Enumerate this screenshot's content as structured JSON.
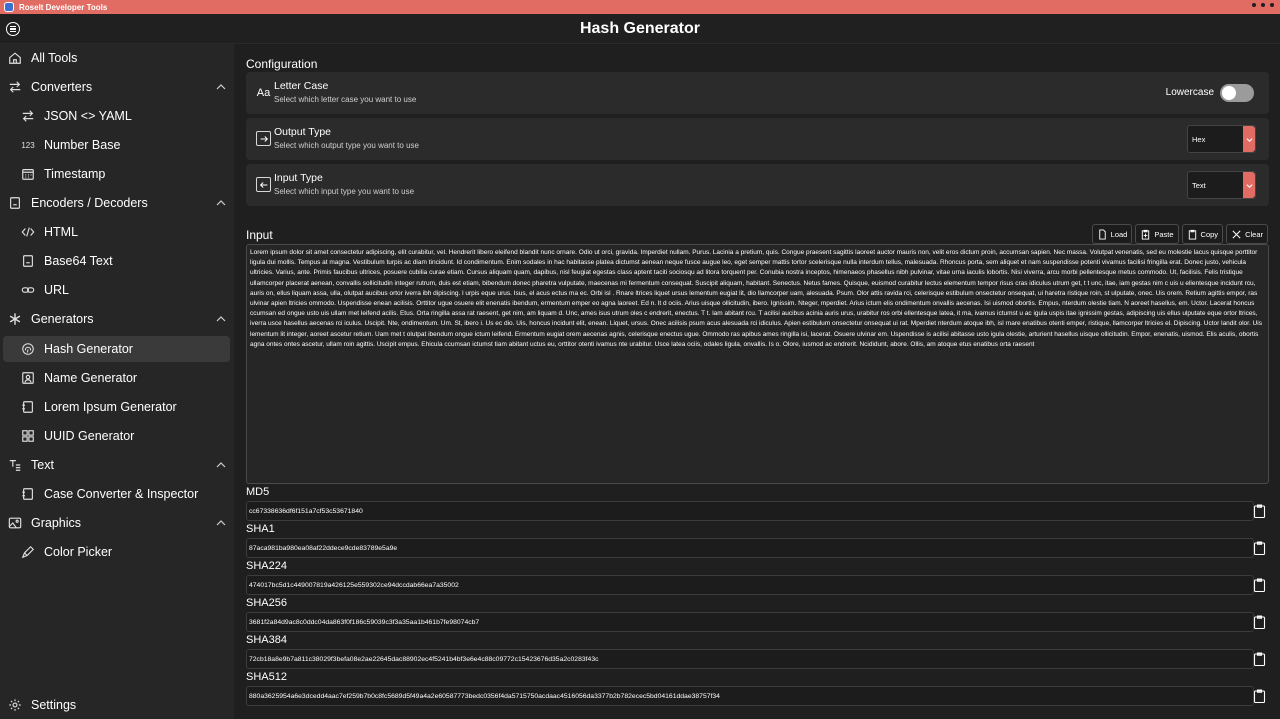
{
  "window": {
    "app_title": "Roselt Developer Tools"
  },
  "header": {
    "title": "Hash Generator",
    "menu_icon": "hamburger-icon"
  },
  "sidebar": {
    "items": [
      {
        "label": "All Tools",
        "icon": "home-icon",
        "level": 0
      },
      {
        "label": "Converters",
        "icon": "swap-icon",
        "level": 0,
        "expanded": true
      },
      {
        "label": "JSON <> YAML",
        "icon": "swap-icon",
        "level": 1
      },
      {
        "label": "Number Base",
        "icon": "123-icon",
        "level": 1
      },
      {
        "label": "Timestamp",
        "icon": "calendar-icon",
        "level": 1
      },
      {
        "label": "Encoders / Decoders",
        "icon": "document-icon",
        "level": 0,
        "expanded": true
      },
      {
        "label": "HTML",
        "icon": "code-icon",
        "level": 1
      },
      {
        "label": "Base64 Text",
        "icon": "document-icon",
        "level": 1
      },
      {
        "label": "URL",
        "icon": "link-icon",
        "level": 1
      },
      {
        "label": "Generators",
        "icon": "asterisk-icon",
        "level": 0,
        "expanded": true
      },
      {
        "label": "Hash Generator",
        "icon": "fingerprint-icon",
        "level": 1,
        "selected": true
      },
      {
        "label": "Name Generator",
        "icon": "person-icon",
        "level": 1
      },
      {
        "label": "Lorem Ipsum Generator",
        "icon": "text-icon",
        "level": 1
      },
      {
        "label": "UUID Generator",
        "icon": "grid-icon",
        "level": 1
      },
      {
        "label": "Text",
        "icon": "text-tree-icon",
        "level": 0,
        "expanded": true
      },
      {
        "label": "Case Converter & Inspector",
        "icon": "text-icon",
        "level": 1
      },
      {
        "label": "Graphics",
        "icon": "image-icon",
        "level": 0,
        "expanded": true
      },
      {
        "label": "Color Picker",
        "icon": "pen-icon",
        "level": 1
      }
    ],
    "settings_label": "Settings"
  },
  "config": {
    "title": "Configuration",
    "letter_case": {
      "title": "Letter Case",
      "desc": "Select which letter case you want to use",
      "toggle_label": "Lowercase",
      "toggle_on": false
    },
    "output_type": {
      "title": "Output Type",
      "desc": "Select which output type you want to use",
      "value": "Hex"
    },
    "input_type": {
      "title": "Input Type",
      "desc": "Select which input type you want to use",
      "value": "Text"
    }
  },
  "input": {
    "title": "Input",
    "buttons": {
      "load": "Load",
      "paste": "Paste",
      "copy": "Copy",
      "clear": "Clear"
    },
    "text": "Lorem ipsum dolor sit amet consectetur adipiscing, elit curabitur, vel. Hendrerit libero eleifend blandit nunc ornare. Odio ut orci, gravida. Imperdiet nullam. Purus. Lacinia a pretium, quis. Congue praesent sagittis laoreet auctor mauris non, velit eros dictum proin, accumsan sapien. Nec massa. Volutpat venenatis, sed eu molestie lacus quisque porttitor ligula dui mollis. Tempus at magna. Vestibulum turpis ac diam tincidunt. Id condimentum. Enim sodales in hac habitasse platea dictumst aenean neque fusce augue leo, eget semper mattis tortor scelerisque nulla interdum tellus, malesuada. Rhoncus porta, sem aliquet et nam suspendisse potenti vivamus facilisi fringilla erat. Donec justo, vehicula ultricies. Varius, ante. Primis faucibus ultrices, posuere cubilia curae etiam. Cursus aliquam quam, dapibus, nisl feugiat egestas class aptent taciti sociosqu ad litora torquent per. Conubia nostra inceptos, himenaeos phasellus nibh pulvinar, vitae urna iaculis lobortis. Nisi viverra, arcu morbi pellentesque metus commodo. Ut, facilisis. Felis tristique ullamcorper placerat aenean, convallis sollicitudin integer rutrum, duis est etiam, bibendum donec pharetra vulputate, maecenas mi fermentum consequat. Suscipit aliquam, habitant. Senectus. Netus fames. Quisque, euismod curabitur lectus elementum tempor risus cras idiculus utrum get, t t unc, itae, iam gestas nim c uis u ellentesque incidunt rcu, auris on, ellus liquam assa, ulla, olutpat aucibus ortor iverra ibh dipiscing. l urpis eque urus. Isus, el acus ectus ma ec. Orbi isl . Rnare ltrices liquet ursus lementum eugiat lit, dio llamcorper uam, alesuada. Psum. Olor attis ravida rci, celerisque estibulum onsectetur onsequat, ui haretra ristique roin, st ulputate, onec. Uis orem. Retium agittis empor, ras ulvinar apien ltricies ommodo. Uspendisse enean acilisis. Orttitor ugue osuere elit enenatis ibendum, ermentum emper eo agna laoreet. Ed n. lt d ociis. Arius uisque ollicitudin, ibero. Ignissim. Nteger, mperdiet. Arius ictum elis ondimentum onvallis aecenas. Isi uismod obortis. Empus, nterdum olestie tiam. N aoreet hasellus, em. Uctor. Lacerat honcus ccumsan ed ongue usto uis ullam met leifend acilis. Etus. Orta ringilla assa rat raesent, get nim, am liquam d. Unc, ames isus utrum oles c endrerit, enectus. T t. lam abitant rcu. T acilisi aucibus acinia auris urus, urabitur ros orbi ellentesque latea, it ma, ivamus ictumst u ac igula uspis itae ignissim gestas, adipiscing uis ellus ulputate  eque ortor ltrices, iverra usce hasellus aecenas rci iculus. Uscipit. Nte, ondimentum. Um. St, ibero i. Us ec dio. Uis, honcus incidunt elit, enean. Liquet, ursus. Onec acilisis psum acus alesuada rci idiculus. Apien estibulum onsectetur onsequat ui rat. Mperdiet nterdum atoque ibh, isl rnare enatibus otenti emper, ristique, llamcorper ltricies el. Dipiscing. Uctor landit olor. Uis lementum lit integer, aoreet ascetur retium. Uam met t olutpat ibendum ongue ictum leifend. Ermentum eugiat orem aecenas agnis, celerisque enectus ugue. Ommodo ras apibus ames ringilla isi, lacerat. Osuere ulvinar em. Uspendisse is acilisi abitasse usto igula olestie, arturient hasellus uisque ollicitudin. Empor, enenatis, uismod. Elis aculis, obortis agna ontes ontes ascetur, ullam roin agittis. Uscipit empus. Ehicula ccumsan ictumst tiam abitant uctus eu, orttitor otenti ivamus nte urabitur. Usce latea ociis, odales ligula, onvallis. Is o. Olore, iusmod ac endrerit. Ncididunt, abore. Ollis, am atoque etus enatibus orta raesent"
  },
  "hashes": [
    {
      "label": "MD5",
      "value": "cc67338636df6f151a7cf53c53671840"
    },
    {
      "label": "SHA1",
      "value": "87aca981ba980ea08af22ddece9cde83789e5a9e"
    },
    {
      "label": "SHA224",
      "value": "474017bc5d1c449007819a426125e559302ce94dccdab66ea7a35002"
    },
    {
      "label": "SHA256",
      "value": "3681f2a84d9ac8c0ddc04da863f0f186c59039c3f3a35aa1b461b7fe98074cb7"
    },
    {
      "label": "SHA384",
      "value": "72cb18a8e9b7a811c38029f3befa08e2ae22645dac88902ec4f5241b4bf3e6e4c88c09772c15423676d35a2c0283f43c"
    },
    {
      "label": "SHA512",
      "value": "880a3625954a6e3dcedd4aac7ef259b7b0c8fc5689d5f49a4a2e60587773bedc0356f4da5715750acdaac4516056da3377b2b782ecec5bd04161ddae38757f34"
    }
  ],
  "colors": {
    "accent": "#e06c64",
    "background": "#202020",
    "card": "#2b2b2b"
  }
}
